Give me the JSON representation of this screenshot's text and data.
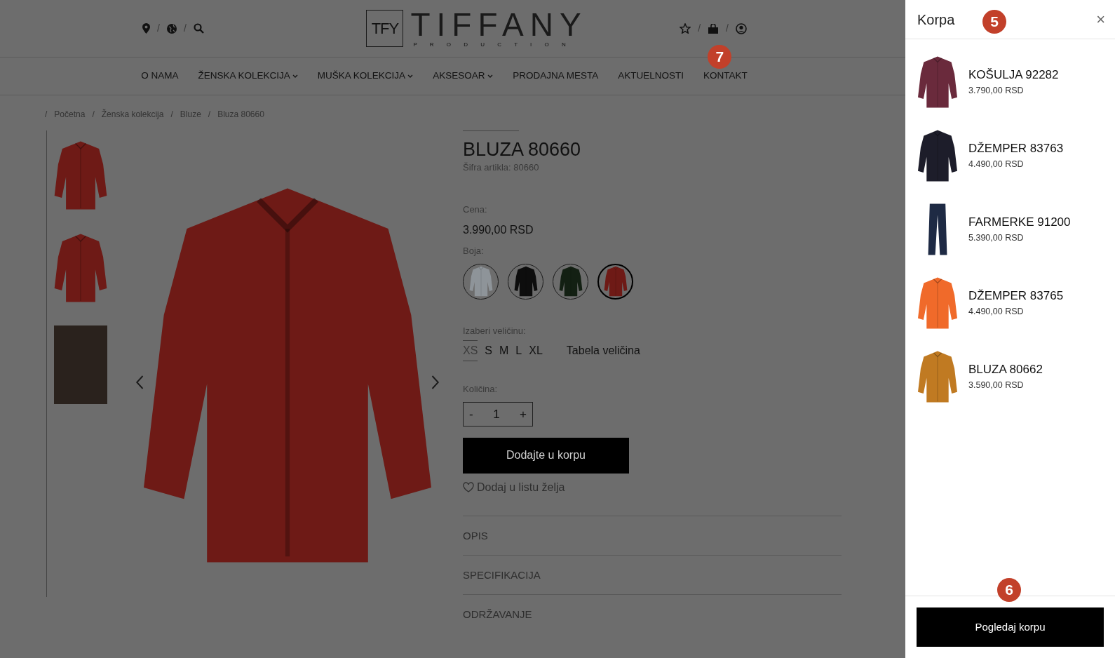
{
  "header": {
    "logo": {
      "mark": "TFY",
      "name": "TIFFANY",
      "tagline": "P R O D U C T I O N"
    },
    "cart_callout": "7",
    "icon_separator": "/"
  },
  "nav": [
    {
      "label": "O NAMA",
      "dropdown": false
    },
    {
      "label": "ŽENSKA KOLEKCIJA",
      "dropdown": true
    },
    {
      "label": "MUŠKA KOLEKCIJA",
      "dropdown": true
    },
    {
      "label": "AKSESOAR",
      "dropdown": true
    },
    {
      "label": "PRODAJNA MESTA",
      "dropdown": false
    },
    {
      "label": "AKTUELNOSTI",
      "dropdown": false
    },
    {
      "label": "KONTAKT",
      "dropdown": false
    }
  ],
  "breadcrumb_separator": "/",
  "breadcrumb": [
    "Početna",
    "Ženska kolekcija",
    "Bluze",
    "Bluza 80660"
  ],
  "gallery": [
    {
      "kind": "garment"
    },
    {
      "kind": "garment"
    },
    {
      "kind": "photo"
    }
  ],
  "product": {
    "title": "BLUZA 80660",
    "sku": "Šifra artikla: 80660",
    "price_label": "Cena:",
    "price": "3.990,00 RSD",
    "color_label": "Boja:",
    "colors": [
      {
        "color": "#8e9499",
        "selected": false
      },
      {
        "color": "#0d0d0d",
        "selected": false
      },
      {
        "color": "#132013",
        "selected": false
      },
      {
        "color": "#6e1a16",
        "selected": true
      }
    ],
    "size_label": "Izaberi veličinu:",
    "sizes": [
      {
        "label": "XS",
        "disabled": true
      },
      {
        "label": "S",
        "disabled": false
      },
      {
        "label": "M",
        "disabled": false
      },
      {
        "label": "L",
        "disabled": false
      },
      {
        "label": "XL",
        "disabled": false
      }
    ],
    "size_chart": "Tabela veličina",
    "quantity_label": "Količina:",
    "minus": "-",
    "quantity": "1",
    "plus": "+",
    "add_button": "Dodajte u korpu",
    "wishlist": "Dodaj u listu želja",
    "sections": [
      "OPIS",
      "SPECIFIKACIJA",
      "ODRŽAVANJE"
    ]
  },
  "cart": {
    "title": "Korpa",
    "callout": "5",
    "close": "×",
    "items": [
      {
        "name": "KOŠULJA 92282",
        "price": "3.790,00 RSD",
        "kind": "top",
        "color": "#6a2a3c"
      },
      {
        "name": "DŽEMPER 83763",
        "price": "4.490,00 RSD",
        "kind": "top",
        "color": "#1d1d2a"
      },
      {
        "name": "FARMERKE 91200",
        "price": "5.390,00 RSD",
        "kind": "pants",
        "color": "#1e2a44"
      },
      {
        "name": "DŽEMPER 83765",
        "price": "4.490,00 RSD",
        "kind": "top",
        "color": "#f06a2a"
      },
      {
        "name": "BLUZA 80662",
        "price": "3.590,00 RSD",
        "kind": "top",
        "color": "#c07a22"
      }
    ],
    "footer_callout": "6",
    "button": "Pogledaj korpu"
  }
}
